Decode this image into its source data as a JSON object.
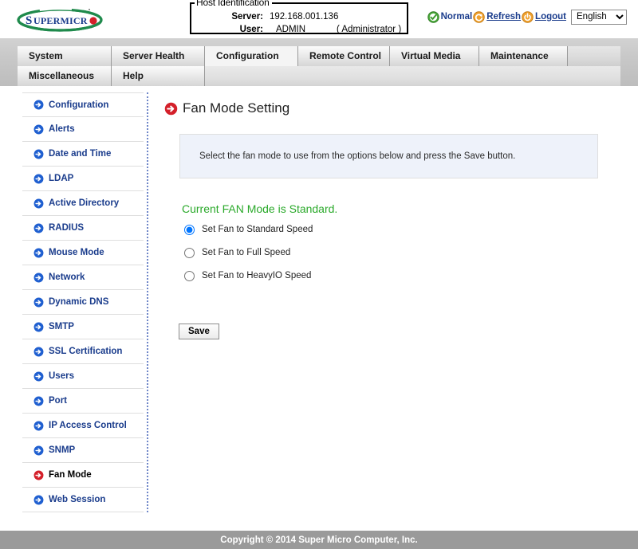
{
  "brand": {
    "logo_text": "SUPERMICR",
    "logo_colors": {
      "ellipse": "#1f8a4c",
      "text": "#1a3c8c",
      "dot": "#d4202a"
    }
  },
  "host_identification": {
    "legend": "Host Identification",
    "server_label": "Server:",
    "server_value": "192.168.001.136",
    "user_label": "User:",
    "user_value": "ADMIN",
    "user_role": "( Administrator )"
  },
  "topbar": {
    "status_label": "Normal",
    "status_icon": "green-check-icon",
    "refresh_label": "Refresh",
    "refresh_icon": "refresh-icon",
    "logout_label": "Logout",
    "logout_icon": "power-icon",
    "language_selected": "English",
    "language_options": [
      "English"
    ]
  },
  "menu": {
    "row1": [
      {
        "label": "System",
        "active": false,
        "width": 118
      },
      {
        "label": "Server Health",
        "active": false,
        "width": 117
      },
      {
        "label": "Configuration",
        "active": true,
        "width": 117
      },
      {
        "label": "Remote Control",
        "active": false,
        "width": 115
      },
      {
        "label": "Virtual Media",
        "active": false,
        "width": 112
      },
      {
        "label": "Maintenance",
        "active": false,
        "width": 111
      }
    ],
    "row2": [
      {
        "label": "Miscellaneous",
        "active": false,
        "width": 118
      },
      {
        "label": "Help",
        "active": false,
        "width": 117
      }
    ]
  },
  "sidebar": {
    "items": [
      {
        "label": "Configuration",
        "active": false
      },
      {
        "label": "Alerts",
        "active": false
      },
      {
        "label": "Date and Time",
        "active": false
      },
      {
        "label": "LDAP",
        "active": false
      },
      {
        "label": "Active Directory",
        "active": false
      },
      {
        "label": "RADIUS",
        "active": false
      },
      {
        "label": "Mouse Mode",
        "active": false
      },
      {
        "label": "Network",
        "active": false
      },
      {
        "label": "Dynamic DNS",
        "active": false
      },
      {
        "label": "SMTP",
        "active": false
      },
      {
        "label": "SSL Certification",
        "active": false
      },
      {
        "label": "Users",
        "active": false
      },
      {
        "label": "Port",
        "active": false
      },
      {
        "label": "IP Access Control",
        "active": false
      },
      {
        "label": "SNMP",
        "active": false
      },
      {
        "label": "Fan Mode",
        "active": true
      },
      {
        "label": "Web Session",
        "active": false
      }
    ]
  },
  "main": {
    "page_title": "Fan Mode Setting",
    "page_title_icon": "red-arrow-icon",
    "info_text": "Select the fan mode to use from the options below and press the Save button.",
    "fan_status_text": "Current FAN Mode is Standard.",
    "fan_status_color": "#2aa92a",
    "options": [
      {
        "label": "Set Fan to Standard Speed",
        "checked": true
      },
      {
        "label": "Set Fan to Full Speed",
        "checked": false
      },
      {
        "label": "Set Fan to HeavyIO Speed",
        "checked": false
      }
    ],
    "save_label": "Save"
  },
  "footer": {
    "copyright": "Copyright © 2014 Super Micro Computer, Inc."
  }
}
